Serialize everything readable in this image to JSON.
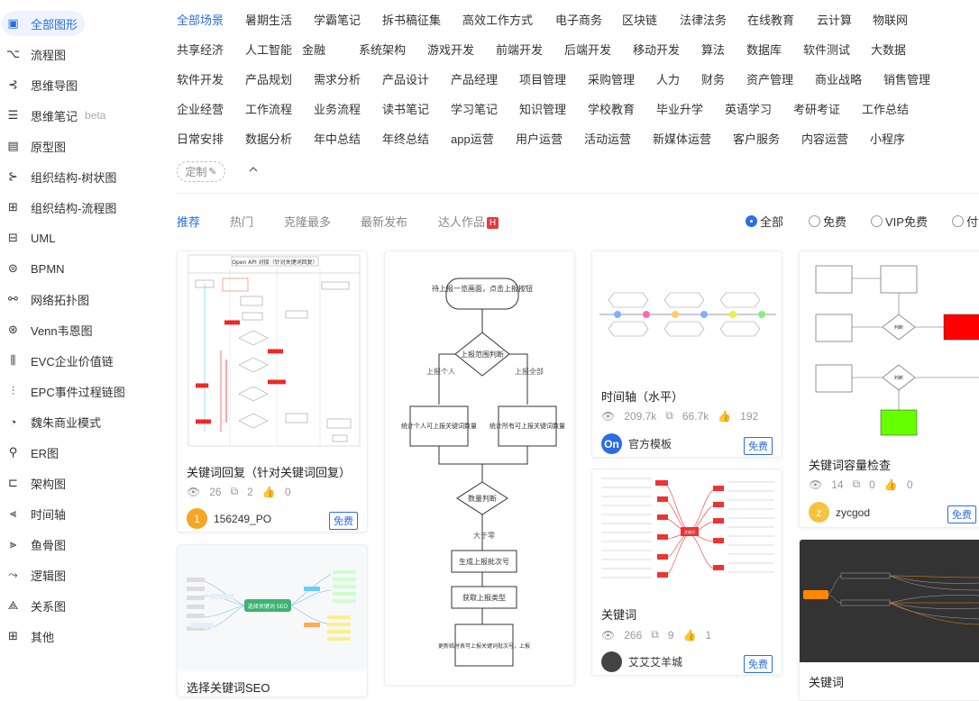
{
  "sidebar": {
    "items": [
      {
        "label": "全部图形",
        "icon": "all-shapes-icon"
      },
      {
        "label": "流程图",
        "icon": "flowchart-icon"
      },
      {
        "label": "思维导图",
        "icon": "mindmap-icon"
      },
      {
        "label": "思维笔记",
        "icon": "mindnote-icon",
        "badge": "beta"
      },
      {
        "label": "原型图",
        "icon": "prototype-icon"
      },
      {
        "label": "组织结构-树状图",
        "icon": "org-tree-icon"
      },
      {
        "label": "组织结构-流程图",
        "icon": "org-flow-icon"
      },
      {
        "label": "UML",
        "icon": "uml-icon"
      },
      {
        "label": "BPMN",
        "icon": "bpmn-icon"
      },
      {
        "label": "网络拓扑图",
        "icon": "network-icon"
      },
      {
        "label": "Venn韦恩图",
        "icon": "venn-icon"
      },
      {
        "label": "EVC企业价值链",
        "icon": "evc-icon"
      },
      {
        "label": "EPC事件过程链图",
        "icon": "epc-icon"
      },
      {
        "label": "魏朱商业模式",
        "icon": "business-model-icon"
      },
      {
        "label": "ER图",
        "icon": "er-icon"
      },
      {
        "label": "架构图",
        "icon": "architecture-icon"
      },
      {
        "label": "时间轴",
        "icon": "timeline-icon"
      },
      {
        "label": "鱼骨图",
        "icon": "fishbone-icon"
      },
      {
        "label": "逻辑图",
        "icon": "logic-icon"
      },
      {
        "label": "关系图",
        "icon": "relation-icon"
      },
      {
        "label": "其他",
        "icon": "other-icon"
      }
    ]
  },
  "scenes": {
    "rows": [
      [
        "全部场景",
        "暑期生活",
        "学霸笔记",
        "拆书稿征集",
        "高效工作方式",
        "电子商务",
        "区块链",
        "法律法务",
        "在线教育",
        "云计算",
        "物联网"
      ],
      [
        "共享经济",
        "人工智能",
        "金融",
        "系统架构",
        "游戏开发",
        "前端开发",
        "后端开发",
        "移动开发",
        "算法",
        "数据库",
        "软件测试",
        "大数据"
      ],
      [
        "软件开发",
        "产品规划",
        "需求分析",
        "产品设计",
        "产品经理",
        "项目管理",
        "采购管理",
        "人力",
        "财务",
        "资产管理",
        "商业战略",
        "销售管理"
      ],
      [
        "企业经营",
        "工作流程",
        "业务流程",
        "读书笔记",
        "学习笔记",
        "知识管理",
        "学校教育",
        "毕业升学",
        "英语学习",
        "考研考证",
        "工作总结"
      ],
      [
        "日常安排",
        "数据分析",
        "年中总结",
        "年终总结",
        "app运营",
        "用户运营",
        "活动运营",
        "新媒体运营",
        "客户服务",
        "内容运营",
        "小程序"
      ]
    ],
    "custom_label": "定制",
    "collapse_icon": "chevron-up-icon"
  },
  "subtabs": [
    "推荐",
    "热门",
    "克隆最多",
    "最新发布",
    "达人作品"
  ],
  "hot_badge": "H",
  "filters": [
    "全部",
    "免费",
    "VIP免费",
    "付"
  ],
  "cards": [
    {
      "title": "关键词回复（针对关键词回复）",
      "views": "26",
      "clones": "2",
      "likes": "0",
      "author": "156249_PO",
      "avatar_text": "1",
      "avatar_color": "#f5a623",
      "tag": "免费"
    },
    {
      "title": "时间轴（水平）",
      "views": "209.7k",
      "clones": "66.7k",
      "likes": "192",
      "author": "官方模板",
      "avatar_text": "On",
      "avatar_color": "#2b6de5",
      "tag": "免费"
    },
    {
      "title": "关键词",
      "views": "266",
      "clones": "9",
      "likes": "1",
      "author": "艾艾艾羊城",
      "avatar_text": "",
      "avatar_color": "#444",
      "tag": "免费"
    },
    {
      "title": "关键词容量检查",
      "views": "14",
      "clones": "0",
      "likes": "0",
      "author": "zycgod",
      "avatar_text": "z",
      "avatar_color": "#f5c242",
      "tag": "免费"
    },
    {
      "title": "选择关键词SEO"
    },
    {
      "title": "关键词"
    }
  ],
  "thumb_texts": {
    "api_title": "Open API 对接（针对关键词回复）",
    "flow_start": "待上报一览画面，点击上报按钮",
    "flow_decide": "上报范围判断",
    "flow_left_label": "上报个人",
    "flow_right_label": "上报全部",
    "flow_left_box": "统计个人可上报关键词数量",
    "flow_right_box": "统计所有可上报关键词数量",
    "flow_qty": "数量判断",
    "flow_gt0": "大于零",
    "flow_gen": "生成上报批次号",
    "flow_get": "获取上报类型",
    "flow_update": "更新临时表可上报关键词批次号，上报",
    "seo_center": "选择关键词 SEO",
    "kw_center": "关键词",
    "check_judge": "判断"
  }
}
